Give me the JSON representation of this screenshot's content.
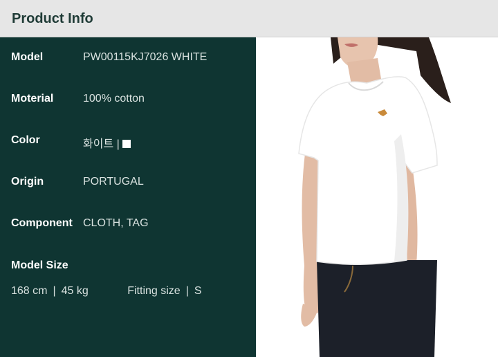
{
  "header": {
    "title": "Product Info"
  },
  "info": {
    "model": {
      "label": "Model",
      "value": "PW00115KJ7026 WHITE"
    },
    "material": {
      "label": "Moterial",
      "value": "100% cotton"
    },
    "color": {
      "label": "Color",
      "value": "화이트 |",
      "swatch_color": "#ffffff"
    },
    "origin": {
      "label": "Origin",
      "value": "PORTUGAL"
    },
    "component": {
      "label": "Component",
      "value": "CLOTH, TAG"
    }
  },
  "model_size": {
    "label": "Model Size",
    "height": "168 cm",
    "weight": "45 kg",
    "fitting_label": "Fitting size",
    "fitting_value": "S",
    "separator": "|"
  },
  "colors": {
    "panel_bg": "#0f3532",
    "header_bg": "#e6e6e6",
    "shirt": "#ffffff",
    "jeans": "#1c2029",
    "hair": "#2a1f1b"
  }
}
